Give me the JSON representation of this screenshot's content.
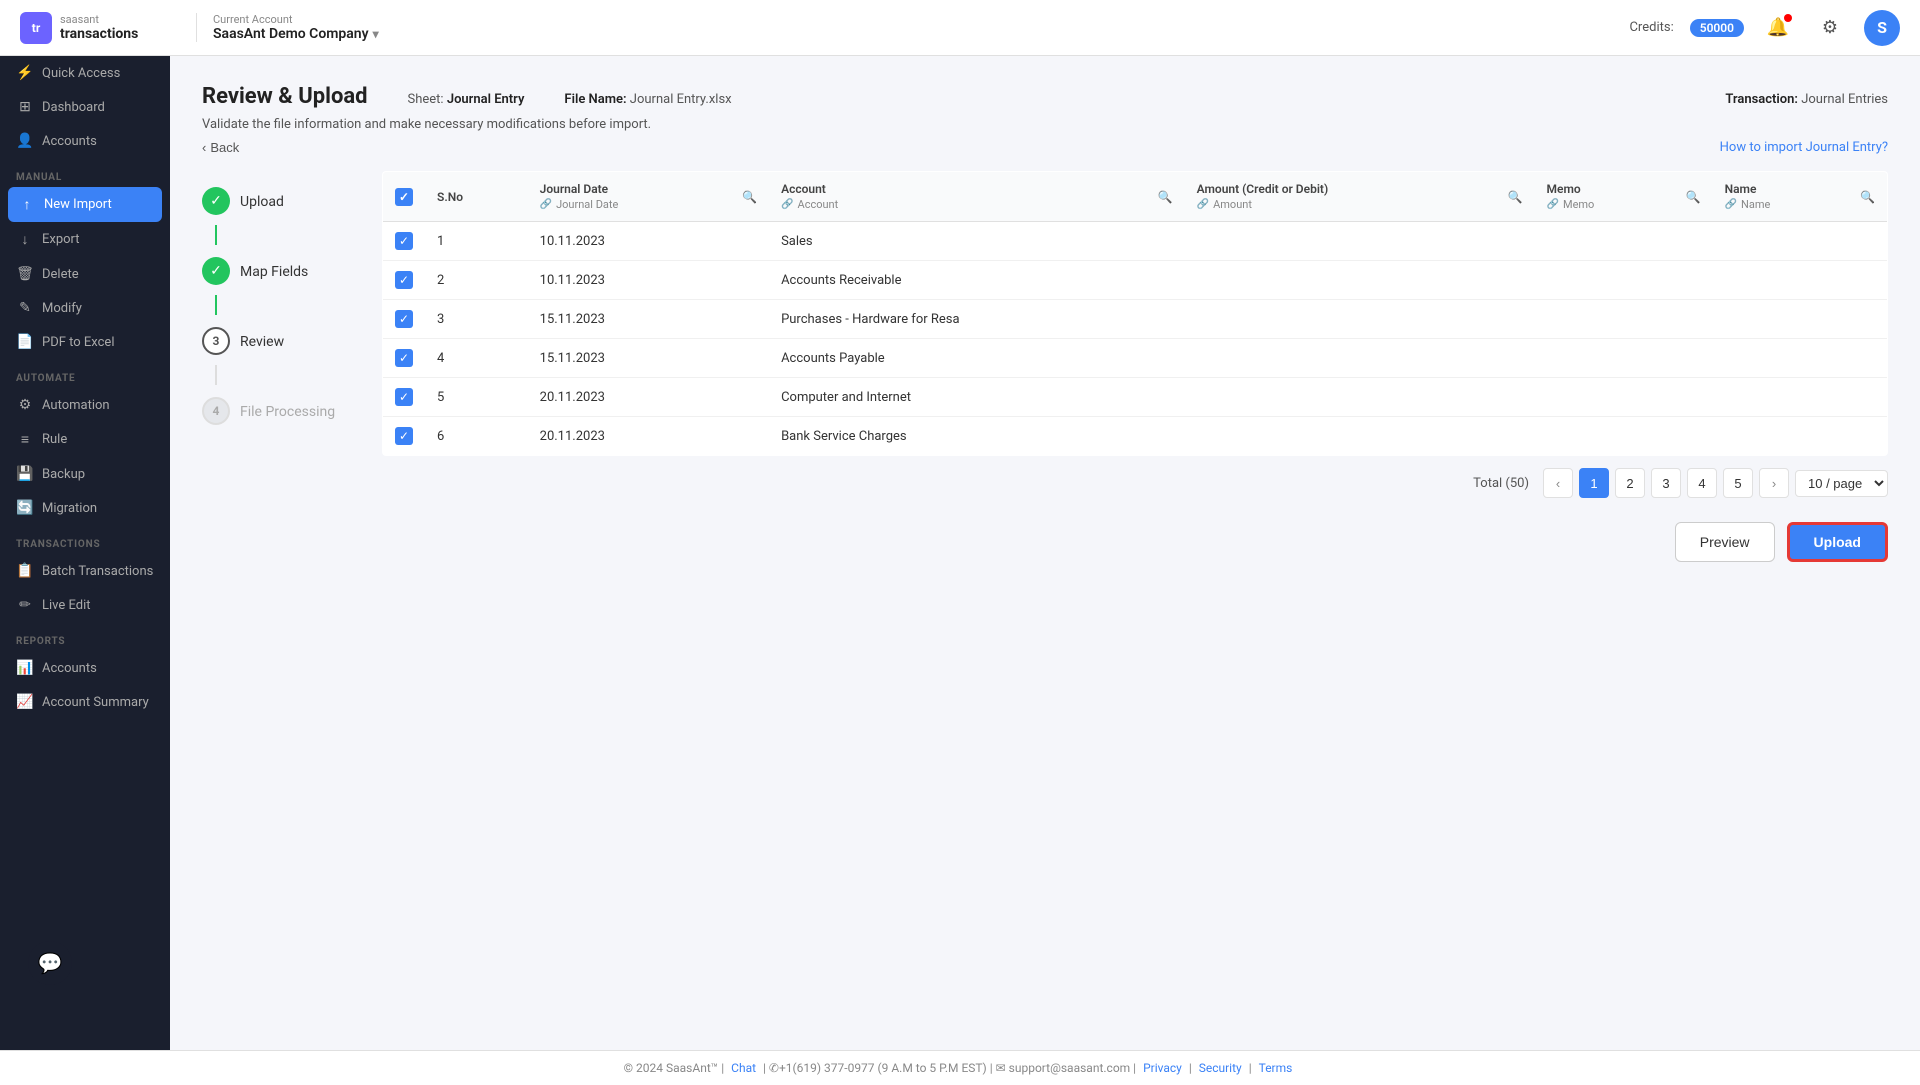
{
  "header": {
    "logo_initials": "tr",
    "logo_brand": "saasant",
    "logo_product": "transactions",
    "account_label": "Current Account",
    "account_name": "SaasAnt Demo Company",
    "credits_label": "Credits:",
    "credits_value": "50000",
    "avatar_letter": "S"
  },
  "sidebar": {
    "sections": [
      {
        "label": "MANUAL",
        "items": [
          {
            "id": "quick-access",
            "label": "Quick Access",
            "icon": "⚡"
          },
          {
            "id": "dashboard",
            "label": "Dashboard",
            "icon": "⊞"
          },
          {
            "id": "accounts",
            "label": "Accounts",
            "icon": "👤"
          }
        ]
      },
      {
        "label": "MANUAL",
        "items": [
          {
            "id": "new-import",
            "label": "New Import",
            "icon": "↑",
            "active": true
          },
          {
            "id": "export",
            "label": "Export",
            "icon": "↓"
          },
          {
            "id": "delete",
            "label": "Delete",
            "icon": "🗑"
          },
          {
            "id": "modify",
            "label": "Modify",
            "icon": "✎"
          },
          {
            "id": "pdf-to-excel",
            "label": "PDF to Excel",
            "icon": "📄"
          }
        ]
      },
      {
        "label": "AUTOMATE",
        "items": [
          {
            "id": "automation",
            "label": "Automation",
            "icon": "⚙"
          },
          {
            "id": "rule",
            "label": "Rule",
            "icon": "≡"
          },
          {
            "id": "backup",
            "label": "Backup",
            "icon": "💾"
          },
          {
            "id": "migration",
            "label": "Migration",
            "icon": "🔄"
          }
        ]
      },
      {
        "label": "TRANSACTIONS",
        "items": [
          {
            "id": "batch-transactions",
            "label": "Batch Transactions",
            "icon": "📋"
          },
          {
            "id": "live-edit",
            "label": "Live Edit",
            "icon": "✏"
          }
        ]
      },
      {
        "label": "REPORTS",
        "items": [
          {
            "id": "accounts-report",
            "label": "Accounts",
            "icon": "📊"
          },
          {
            "id": "account-summary",
            "label": "Account Summary",
            "icon": "📈"
          }
        ]
      }
    ]
  },
  "page": {
    "title": "Review & Upload",
    "sheet_label": "Sheet:",
    "sheet_value": "Journal Entry",
    "filename_label": "File Name:",
    "filename_value": "Journal Entry.xlsx",
    "transaction_label": "Transaction:",
    "transaction_value": "Journal Entries",
    "description": "Validate the file information and make necessary modifications before import.",
    "back_label": "Back",
    "how_to_link": "How to import Journal Entry?"
  },
  "steps": [
    {
      "id": "upload",
      "label": "Upload",
      "status": "done",
      "number": ""
    },
    {
      "id": "map-fields",
      "label": "Map Fields",
      "status": "done",
      "number": ""
    },
    {
      "id": "review",
      "label": "Review",
      "status": "active",
      "number": "3"
    },
    {
      "id": "file-processing",
      "label": "File Processing",
      "status": "inactive",
      "number": "4"
    }
  ],
  "table": {
    "columns": [
      {
        "id": "sno",
        "label": "S.No",
        "sub": ""
      },
      {
        "id": "journal-date",
        "label": "Journal Date",
        "sub": "Journal Date",
        "searchable": true
      },
      {
        "id": "account",
        "label": "Account",
        "sub": "Account",
        "searchable": true
      },
      {
        "id": "amount",
        "label": "Amount (Credit or Debit)",
        "sub": "Amount",
        "searchable": true
      },
      {
        "id": "memo",
        "label": "Memo",
        "sub": "Memo",
        "searchable": true
      },
      {
        "id": "name",
        "label": "Name",
        "sub": "Name",
        "searchable": true
      }
    ],
    "rows": [
      {
        "sno": 1,
        "journal_date": "10.11.2023",
        "account": "Sales",
        "amount": "",
        "memo": "",
        "name": ""
      },
      {
        "sno": 2,
        "journal_date": "10.11.2023",
        "account": "Accounts Receivable",
        "amount": "",
        "memo": "",
        "name": ""
      },
      {
        "sno": 3,
        "journal_date": "15.11.2023",
        "account": "Purchases - Hardware for Resa",
        "amount": "",
        "memo": "",
        "name": ""
      },
      {
        "sno": 4,
        "journal_date": "15.11.2023",
        "account": "Accounts Payable",
        "amount": "",
        "memo": "",
        "name": ""
      },
      {
        "sno": 5,
        "journal_date": "20.11.2023",
        "account": "Computer and Internet",
        "amount": "",
        "memo": "",
        "name": ""
      },
      {
        "sno": 6,
        "journal_date": "20.11.2023",
        "account": "Bank Service Charges",
        "amount": "",
        "memo": "",
        "name": ""
      }
    ]
  },
  "pagination": {
    "total_label": "Total (50)",
    "pages": [
      1,
      2,
      3,
      4,
      5
    ],
    "active_page": 1,
    "per_page": "10 / page"
  },
  "actions": {
    "preview_label": "Preview",
    "upload_label": "Upload"
  },
  "footer": {
    "copyright": "© 2024 SaasAnt™",
    "chat_label": "Chat",
    "phone": "✆+1(619) 377-0977 (9 A.M to 5 P.M EST)",
    "email": "✉ support@saasant.com",
    "privacy": "Privacy",
    "security": "Security",
    "terms": "Terms"
  }
}
